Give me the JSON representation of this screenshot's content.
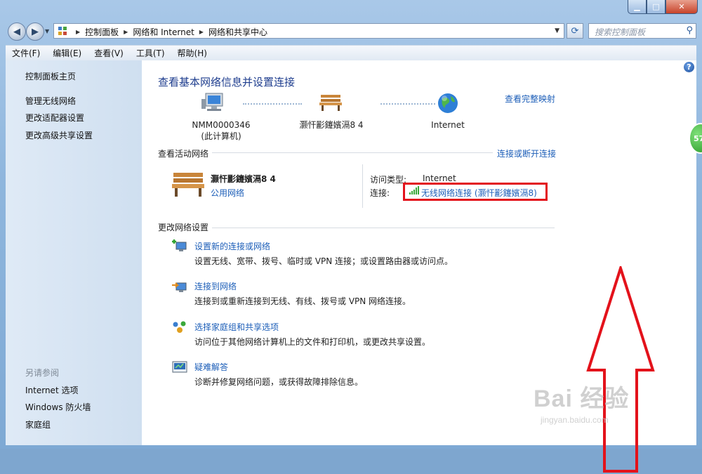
{
  "window": {
    "controls": {
      "minimize": "▁",
      "maximize": "□",
      "close": "✕"
    }
  },
  "nav": {
    "breadcrumb": [
      "控制面板",
      "网络和 Internet",
      "网络和共享中心"
    ],
    "search_placeholder": "搜索控制面板"
  },
  "menu": [
    "文件(F)",
    "编辑(E)",
    "查看(V)",
    "工具(T)",
    "帮助(H)"
  ],
  "sidebar": {
    "home": "控制面板主页",
    "links": [
      "管理无线网络",
      "更改适配器设置",
      "更改高级共享设置"
    ],
    "see_also_title": "另请参阅",
    "see_also": [
      "Internet 选项",
      "Windows 防火墙",
      "家庭组"
    ]
  },
  "main": {
    "heading": "查看基本网络信息并设置连接",
    "view_full_map": "查看完整映射",
    "map_nodes": [
      {
        "line1": "NMM0000346",
        "line2": "(此计算机)"
      },
      {
        "line1": "灏忓彲鑳嬪滆8  4",
        "line2": ""
      },
      {
        "line1": "Internet",
        "line2": ""
      }
    ],
    "active_networks_label": "查看活动网络",
    "connect_disconnect": "连接或断开连接",
    "active_network": {
      "name": "灏忓彲鑳嬪滆8  4",
      "type": "公用网络",
      "access_type_label": "访问类型:",
      "access_type_value": "Internet",
      "connection_label": "连接:",
      "connection_value": "无线网络连接 (灏忓彲鑳嬪滆8)"
    },
    "change_settings_label": "更改网络设置",
    "tasks": [
      {
        "title": "设置新的连接或网络",
        "desc": "设置无线、宽带、拨号、临时或 VPN 连接；或设置路由器或访问点。",
        "icon": "new-connection-icon"
      },
      {
        "title": "连接到网络",
        "desc": "连接到或重新连接到无线、有线、拨号或 VPN 网络连接。",
        "icon": "connect-network-icon"
      },
      {
        "title": "选择家庭组和共享选项",
        "desc": "访问位于其他网络计算机上的文件和打印机，或更改共享设置。",
        "icon": "homegroup-icon"
      },
      {
        "title": "疑难解答",
        "desc": "诊断并修复网络问题，或获得故障排除信息。",
        "icon": "troubleshoot-icon"
      }
    ]
  },
  "overlay": {
    "bubble_text": "57",
    "watermark": "Bai 经验",
    "watermark_url": "jingyan.baidu.com",
    "highlight_color": "#e3121b"
  }
}
